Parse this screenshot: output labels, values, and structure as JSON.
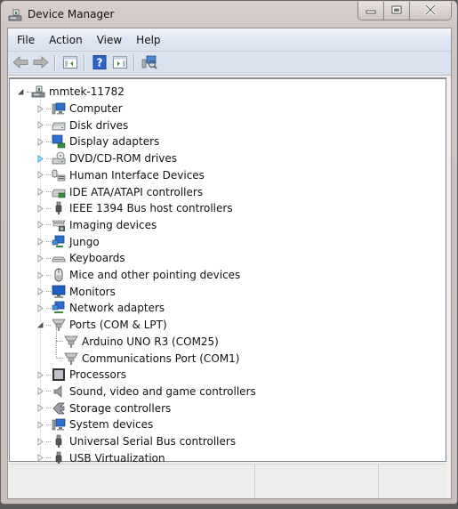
{
  "window": {
    "title": "Device Manager",
    "icon": "device-manager-icon",
    "controls": {
      "minimize": "minimize-icon",
      "maximize": "maximize-icon",
      "close": "close-icon"
    }
  },
  "menubar": {
    "items": [
      "File",
      "Action",
      "View",
      "Help"
    ]
  },
  "toolbar": {
    "buttons": [
      {
        "name": "back-button",
        "icon": "arrow-left-icon"
      },
      {
        "name": "forward-button",
        "icon": "arrow-right-icon"
      },
      {
        "name": "show-hide-console-tree-button",
        "icon": "console-tree-icon"
      },
      {
        "name": "help-button",
        "icon": "help-icon"
      },
      {
        "name": "show-hide-action-pane-button",
        "icon": "action-pane-icon"
      },
      {
        "name": "scan-hardware-button",
        "icon": "scan-hardware-icon"
      }
    ]
  },
  "tree": {
    "root": {
      "label": "mmtek-11782",
      "icon": "computer-network-icon",
      "expanded": true
    },
    "categories": [
      {
        "label": "Computer",
        "icon": "computer-icon",
        "expanded": false
      },
      {
        "label": "Disk drives",
        "icon": "disk-drive-icon",
        "expanded": false
      },
      {
        "label": "Display adapters",
        "icon": "display-adapter-icon",
        "expanded": false
      },
      {
        "label": "DVD/CD-ROM drives",
        "icon": "dvd-drive-icon",
        "expanded": false,
        "hover": true
      },
      {
        "label": "Human Interface Devices",
        "icon": "hid-icon",
        "expanded": false
      },
      {
        "label": "IDE ATA/ATAPI controllers",
        "icon": "ide-controller-icon",
        "expanded": false
      },
      {
        "label": "IEEE 1394 Bus host controllers",
        "icon": "firewire-icon",
        "expanded": false
      },
      {
        "label": "Imaging devices",
        "icon": "imaging-device-icon",
        "expanded": false
      },
      {
        "label": "Jungo",
        "icon": "jungo-icon",
        "expanded": false
      },
      {
        "label": "Keyboards",
        "icon": "keyboard-icon",
        "expanded": false
      },
      {
        "label": "Mice and other pointing devices",
        "icon": "mouse-icon",
        "expanded": false
      },
      {
        "label": "Monitors",
        "icon": "monitor-icon",
        "expanded": false
      },
      {
        "label": "Network adapters",
        "icon": "network-adapter-icon",
        "expanded": false
      },
      {
        "label": "Ports (COM & LPT)",
        "icon": "port-icon",
        "expanded": true,
        "children": [
          {
            "label": "Arduino UNO R3 (COM25)",
            "icon": "port-icon"
          },
          {
            "label": "Communications Port (COM1)",
            "icon": "port-icon"
          }
        ]
      },
      {
        "label": "Processors",
        "icon": "processor-icon",
        "expanded": false
      },
      {
        "label": "Sound, video and game controllers",
        "icon": "sound-icon",
        "expanded": false
      },
      {
        "label": "Storage controllers",
        "icon": "storage-controller-icon",
        "expanded": false
      },
      {
        "label": "System devices",
        "icon": "system-device-icon",
        "expanded": false
      },
      {
        "label": "Universal Serial Bus controllers",
        "icon": "usb-icon",
        "expanded": false
      },
      {
        "label": "USB Virtualization",
        "icon": "usb-icon",
        "expanded": false
      }
    ]
  },
  "statusbar": {
    "panes": [
      "",
      "",
      ""
    ]
  }
}
